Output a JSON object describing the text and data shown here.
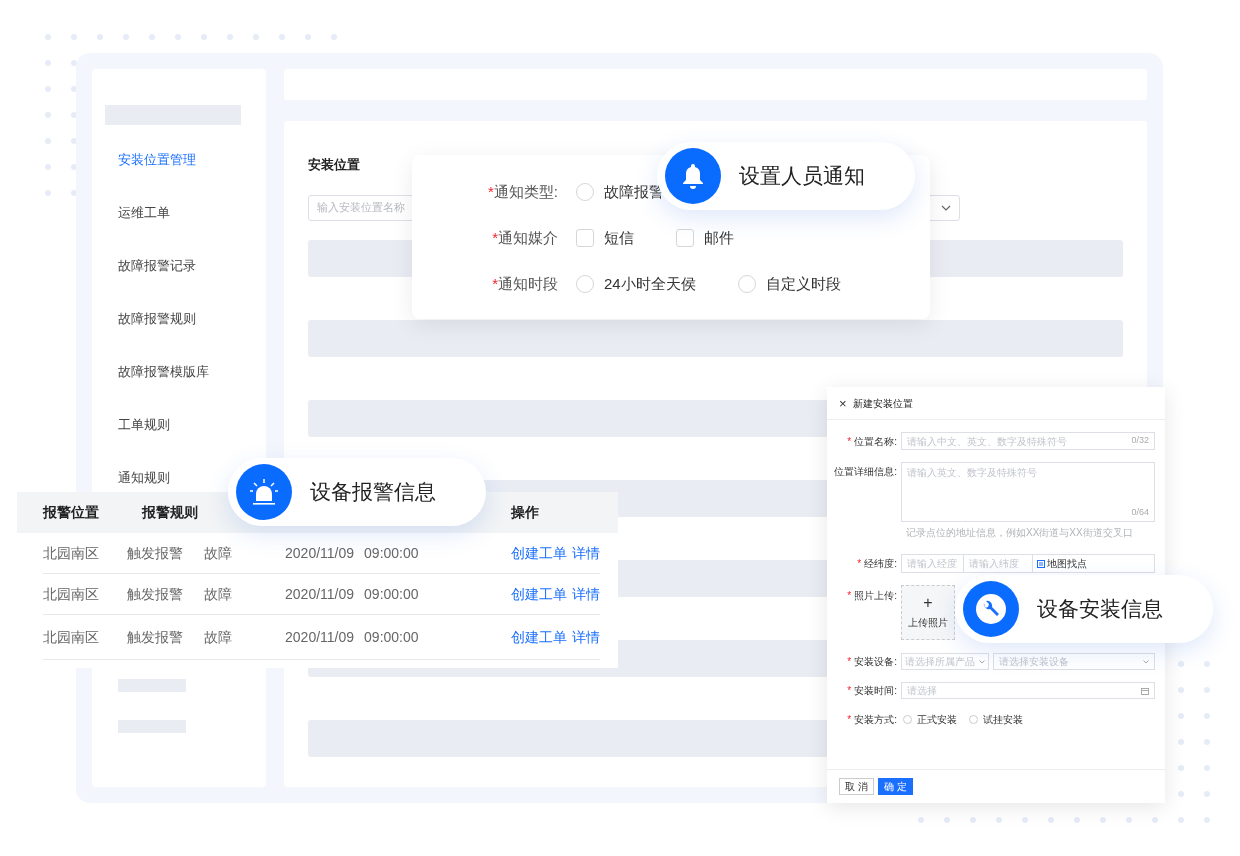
{
  "sidebar": {
    "items": [
      {
        "label": "安装位置管理",
        "selected": true
      },
      {
        "label": "运维工单",
        "selected": false
      },
      {
        "label": "故障报警记录",
        "selected": false
      },
      {
        "label": "故障报警规则",
        "selected": false
      },
      {
        "label": "故障报警模版库",
        "selected": false
      },
      {
        "label": "工单规则",
        "selected": false
      },
      {
        "label": "通知规则",
        "selected": false
      }
    ]
  },
  "main": {
    "title": "安装位置",
    "search": {
      "placeholder": "输入安装位置名称"
    }
  },
  "notification_form": {
    "rows": [
      {
        "label": "通知类型:",
        "required_mark": "*",
        "options": [
          {
            "kind": "radio",
            "label": "故障报警",
            "selected": false
          }
        ]
      },
      {
        "label": "通知媒介",
        "required_mark": "*",
        "options": [
          {
            "kind": "checkbox",
            "label": "短信",
            "checked": false
          },
          {
            "kind": "checkbox",
            "label": "邮件",
            "checked": false
          }
        ]
      },
      {
        "label": "通知时段",
        "required_mark": "*",
        "options": [
          {
            "kind": "radio",
            "label": "24小时全天侯",
            "selected": false
          },
          {
            "kind": "radio",
            "label": "自定义时段",
            "selected": false
          }
        ]
      }
    ]
  },
  "badges": [
    {
      "label": "设置人员通知"
    },
    {
      "label": "设备报警信息"
    },
    {
      "label": "设备安装信息"
    }
  ],
  "alarm_table": {
    "columns": {
      "col_1": "报警位置",
      "col_2": "报警规则",
      "actions": "操作"
    },
    "rows": [
      {
        "location": "北园南区",
        "rule": "触发报警",
        "type": "故障",
        "date": "2020/11/09",
        "time": "09:00:00",
        "actions": [
          "创建工单",
          "详情"
        ]
      },
      {
        "location": "北园南区",
        "rule": "触发报警",
        "type": "故障",
        "date": "2020/11/09",
        "time": "09:00:00",
        "actions": [
          "创建工单",
          "详情"
        ]
      },
      {
        "location": "北园南区",
        "rule": "触发报警",
        "type": "故障",
        "date": "2020/11/09",
        "time": "09:00:00",
        "actions": [
          "创建工单",
          "详情"
        ]
      }
    ]
  },
  "dialog": {
    "close": "×",
    "title": "新建安装位置",
    "name": {
      "required_mark": "*",
      "label": "位置名称:",
      "placeholder": "请输入中文、英文、数字及特殊符号",
      "count": "0/32"
    },
    "detail": {
      "label": "位置详细信息:",
      "placeholder": "请输入英文、数字及特殊符号",
      "count": "0/64",
      "hint": "记录点位的地址信息，例如XX街道与XX街道交叉口"
    },
    "coords": {
      "required_mark": "*",
      "label": "经纬度:",
      "lng_placeholder": "请输入经度",
      "lat_placeholder": "请输入纬度",
      "map_button": "地图找点"
    },
    "photo": {
      "required_mark": "*",
      "label": "照片上传:",
      "plus": "+",
      "button": "上传照片"
    },
    "device": {
      "required_mark": "*",
      "label": "安装设备:",
      "product_placeholder": "请选择所属产品",
      "device_placeholder": "请选择安装设备"
    },
    "time": {
      "required_mark": "*",
      "label": "安装时间:",
      "placeholder": "请选择"
    },
    "method": {
      "required_mark": "*",
      "label": "安装方式:",
      "options": [
        {
          "label": "正式安装",
          "selected": false
        },
        {
          "label": "试挂安装",
          "selected": false
        }
      ]
    },
    "buttons": {
      "cancel": "取 消",
      "ok": "确 定"
    }
  }
}
